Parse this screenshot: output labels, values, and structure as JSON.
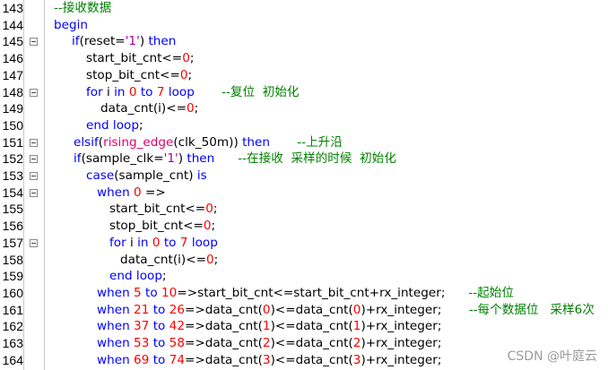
{
  "lines": [
    {
      "n": "143",
      "fold": false,
      "indent": 60,
      "tokens": [
        {
          "t": "--接收数据",
          "c": "cm"
        }
      ]
    },
    {
      "n": "144",
      "fold": false,
      "indent": 60,
      "tokens": [
        {
          "t": "begin",
          "c": "kw"
        }
      ]
    },
    {
      "n": "145",
      "fold": true,
      "indent": 80,
      "tokens": [
        {
          "t": "if",
          "c": "kw"
        },
        {
          "t": "(reset=",
          "c": ""
        },
        {
          "t": "'1'",
          "c": "str"
        },
        {
          "t": ") ",
          "c": ""
        },
        {
          "t": "then",
          "c": "kw"
        }
      ]
    },
    {
      "n": "146",
      "fold": false,
      "indent": 96,
      "tokens": [
        {
          "t": "start_bit_cnt<=",
          "c": ""
        },
        {
          "t": "0",
          "c": "num"
        },
        {
          "t": ";",
          "c": ""
        }
      ]
    },
    {
      "n": "147",
      "fold": false,
      "indent": 96,
      "tokens": [
        {
          "t": "stop_bit_cnt<=",
          "c": ""
        },
        {
          "t": "0",
          "c": "num"
        },
        {
          "t": ";",
          "c": ""
        }
      ]
    },
    {
      "n": "148",
      "fold": true,
      "indent": 96,
      "tokens": [
        {
          "t": "for",
          "c": "kw"
        },
        {
          "t": " i ",
          "c": ""
        },
        {
          "t": "in",
          "c": "kw"
        },
        {
          "t": " ",
          "c": ""
        },
        {
          "t": "0",
          "c": "num"
        },
        {
          "t": " ",
          "c": ""
        },
        {
          "t": "to",
          "c": "kw"
        },
        {
          "t": " ",
          "c": ""
        },
        {
          "t": "7",
          "c": "num"
        },
        {
          "t": " ",
          "c": ""
        },
        {
          "t": "loop",
          "c": "kw"
        },
        {
          "t": "       ",
          "c": ""
        },
        {
          "t": "--复位  初始化",
          "c": "cm"
        }
      ]
    },
    {
      "n": "149",
      "fold": false,
      "indent": 112,
      "tokens": [
        {
          "t": "data_cnt(i)<=",
          "c": ""
        },
        {
          "t": "0",
          "c": "num"
        },
        {
          "t": ";",
          "c": ""
        }
      ]
    },
    {
      "n": "150",
      "fold": false,
      "indent": 96,
      "tokens": [
        {
          "t": "end loop",
          "c": "kw"
        },
        {
          "t": ";",
          "c": ""
        }
      ]
    },
    {
      "n": "151",
      "fold": true,
      "indent": 82,
      "tokens": [
        {
          "t": "elsif",
          "c": "kw"
        },
        {
          "t": "(",
          "c": ""
        },
        {
          "t": "rising_edge",
          "c": "fn"
        },
        {
          "t": "(clk_50m)) ",
          "c": ""
        },
        {
          "t": "then",
          "c": "kw"
        },
        {
          "t": "       ",
          "c": ""
        },
        {
          "t": "--上升沿",
          "c": "cm"
        }
      ]
    },
    {
      "n": "152",
      "fold": true,
      "indent": 82,
      "tokens": [
        {
          "t": "if",
          "c": "kw"
        },
        {
          "t": "(sample_clk=",
          "c": ""
        },
        {
          "t": "'1'",
          "c": "str"
        },
        {
          "t": ") ",
          "c": ""
        },
        {
          "t": "then",
          "c": "kw"
        },
        {
          "t": "      ",
          "c": ""
        },
        {
          "t": "--在接收  采样的时候  初始化",
          "c": "cm"
        }
      ]
    },
    {
      "n": "153",
      "fold": true,
      "indent": 96,
      "tokens": [
        {
          "t": "case",
          "c": "kw"
        },
        {
          "t": "(sample_cnt) ",
          "c": ""
        },
        {
          "t": "is",
          "c": "kw"
        }
      ]
    },
    {
      "n": "154",
      "fold": true,
      "indent": 108,
      "tokens": [
        {
          "t": "when",
          "c": "kw"
        },
        {
          "t": " ",
          "c": ""
        },
        {
          "t": "0",
          "c": "num"
        },
        {
          "t": " =>",
          "c": ""
        }
      ]
    },
    {
      "n": "155",
      "fold": false,
      "indent": 122,
      "tokens": [
        {
          "t": "start_bit_cnt<=",
          "c": ""
        },
        {
          "t": "0",
          "c": "num"
        },
        {
          "t": ";",
          "c": ""
        }
      ]
    },
    {
      "n": "156",
      "fold": false,
      "indent": 122,
      "tokens": [
        {
          "t": "stop_bit_cnt<=",
          "c": ""
        },
        {
          "t": "0",
          "c": "num"
        },
        {
          "t": ";",
          "c": ""
        }
      ]
    },
    {
      "n": "157",
      "fold": true,
      "indent": 122,
      "tokens": [
        {
          "t": "for",
          "c": "kw"
        },
        {
          "t": " i ",
          "c": ""
        },
        {
          "t": "in",
          "c": "kw"
        },
        {
          "t": " ",
          "c": ""
        },
        {
          "t": "0",
          "c": "num"
        },
        {
          "t": " ",
          "c": ""
        },
        {
          "t": "to",
          "c": "kw"
        },
        {
          "t": " ",
          "c": ""
        },
        {
          "t": "7",
          "c": "num"
        },
        {
          "t": " ",
          "c": ""
        },
        {
          "t": "loop",
          "c": "kw"
        }
      ]
    },
    {
      "n": "158",
      "fold": false,
      "indent": 134,
      "tokens": [
        {
          "t": "data_cnt(i)<=",
          "c": ""
        },
        {
          "t": "0",
          "c": "num"
        },
        {
          "t": ";",
          "c": ""
        }
      ]
    },
    {
      "n": "159",
      "fold": false,
      "indent": 122,
      "tokens": [
        {
          "t": "end loop",
          "c": "kw"
        },
        {
          "t": ";",
          "c": ""
        }
      ]
    },
    {
      "n": "160",
      "fold": false,
      "indent": 108,
      "tokens": [
        {
          "t": "when",
          "c": "kw"
        },
        {
          "t": " ",
          "c": ""
        },
        {
          "t": "5",
          "c": "num"
        },
        {
          "t": " ",
          "c": ""
        },
        {
          "t": "to",
          "c": "kw"
        },
        {
          "t": " ",
          "c": ""
        },
        {
          "t": "10",
          "c": "num"
        },
        {
          "t": "=>start_bit_cnt<=start_bit_cnt+rx_integer;      ",
          "c": ""
        },
        {
          "t": "--起始位",
          "c": "cm"
        }
      ]
    },
    {
      "n": "161",
      "fold": false,
      "indent": 108,
      "tokens": [
        {
          "t": "when",
          "c": "kw"
        },
        {
          "t": " ",
          "c": ""
        },
        {
          "t": "21",
          "c": "num"
        },
        {
          "t": " ",
          "c": ""
        },
        {
          "t": "to",
          "c": "kw"
        },
        {
          "t": " ",
          "c": ""
        },
        {
          "t": "26",
          "c": "num"
        },
        {
          "t": "=>data_cnt(",
          "c": ""
        },
        {
          "t": "0",
          "c": "num"
        },
        {
          "t": ")<=data_cnt(",
          "c": ""
        },
        {
          "t": "0",
          "c": "num"
        },
        {
          "t": ")+rx_integer;       ",
          "c": ""
        },
        {
          "t": "--每个数据位   采样6次",
          "c": "cm"
        }
      ]
    },
    {
      "n": "162",
      "fold": false,
      "indent": 108,
      "tokens": [
        {
          "t": "when",
          "c": "kw"
        },
        {
          "t": " ",
          "c": ""
        },
        {
          "t": "37",
          "c": "num"
        },
        {
          "t": " ",
          "c": ""
        },
        {
          "t": "to",
          "c": "kw"
        },
        {
          "t": " ",
          "c": ""
        },
        {
          "t": "42",
          "c": "num"
        },
        {
          "t": "=>data_cnt(",
          "c": ""
        },
        {
          "t": "1",
          "c": "num"
        },
        {
          "t": ")<=data_cnt(",
          "c": ""
        },
        {
          "t": "1",
          "c": "num"
        },
        {
          "t": ")+rx_integer;",
          "c": ""
        }
      ]
    },
    {
      "n": "163",
      "fold": false,
      "indent": 108,
      "tokens": [
        {
          "t": "when",
          "c": "kw"
        },
        {
          "t": " ",
          "c": ""
        },
        {
          "t": "53",
          "c": "num"
        },
        {
          "t": " ",
          "c": ""
        },
        {
          "t": "to",
          "c": "kw"
        },
        {
          "t": " ",
          "c": ""
        },
        {
          "t": "58",
          "c": "num"
        },
        {
          "t": "=>data_cnt(",
          "c": ""
        },
        {
          "t": "2",
          "c": "num"
        },
        {
          "t": ")<=data_cnt(",
          "c": ""
        },
        {
          "t": "2",
          "c": "num"
        },
        {
          "t": ")+rx_integer;",
          "c": ""
        }
      ]
    },
    {
      "n": "164",
      "fold": false,
      "indent": 108,
      "tokens": [
        {
          "t": "when",
          "c": "kw"
        },
        {
          "t": " ",
          "c": ""
        },
        {
          "t": "69",
          "c": "num"
        },
        {
          "t": " ",
          "c": ""
        },
        {
          "t": "to",
          "c": "kw"
        },
        {
          "t": " ",
          "c": ""
        },
        {
          "t": "74",
          "c": "num"
        },
        {
          "t": "=>data_cnt(",
          "c": ""
        },
        {
          "t": "3",
          "c": "num"
        },
        {
          "t": ")<=data_cnt(",
          "c": ""
        },
        {
          "t": "3",
          "c": "num"
        },
        {
          "t": ")+rx_integer;",
          "c": ""
        }
      ]
    }
  ],
  "watermark": "CSDN @叶庭云"
}
